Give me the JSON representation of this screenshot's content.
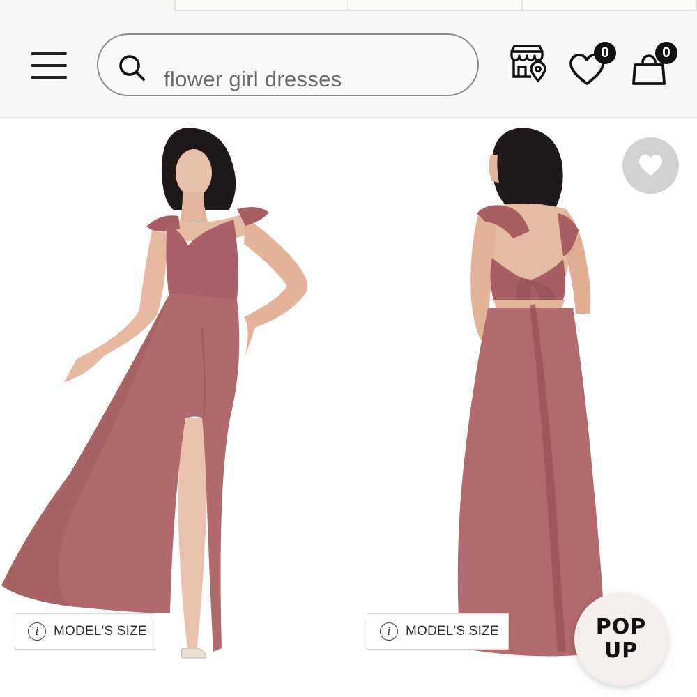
{
  "search": {
    "placeholder": "flower girl dresses"
  },
  "header": {
    "wishlist_count": "0",
    "cart_count": "0"
  },
  "products": [
    {
      "view": "front",
      "model_size_label": "MODEL'S SIZE"
    },
    {
      "view": "back",
      "model_size_label": "MODEL'S SIZE"
    }
  ],
  "popup_button": {
    "line1": "POP",
    "line2": "UP"
  },
  "colors": {
    "dress": "#b0666a",
    "badge": "#111111",
    "header_bg": "#f9f8f6"
  },
  "icons": [
    "menu-icon",
    "search-icon",
    "store-locator-icon",
    "wishlist-heart-icon",
    "shopping-bag-icon",
    "heart-icon",
    "info-icon"
  ]
}
